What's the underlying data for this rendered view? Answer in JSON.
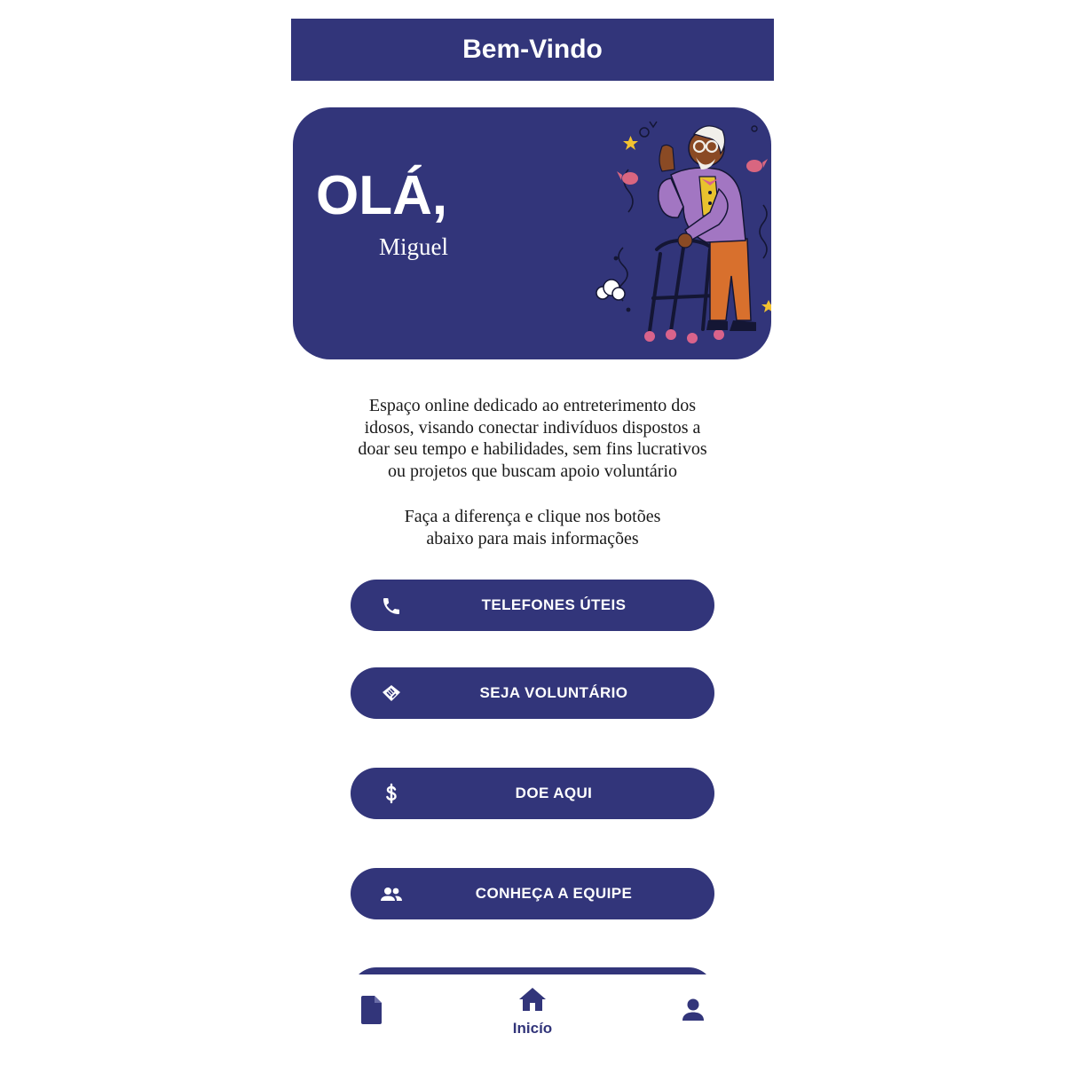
{
  "header": {
    "title": "Bem-Vindo"
  },
  "hero": {
    "greeting": "OLÁ,",
    "user_name": "Miguel",
    "illustration": "elderly-man-with-walker-illustration"
  },
  "intro": {
    "description_lines": [
      "Espaço online dedicado ao entreterimento dos",
      "idosos, visando conectar indivíduos dispostos a",
      "doar seu tempo e habilidades, sem fins lucrativos",
      "ou projetos que buscam apoio voluntário"
    ],
    "cta_lines": [
      "Faça a diferença e clique nos botões",
      "abaixo para mais informações"
    ]
  },
  "actions": [
    {
      "label": "TELEFONES ÚTEIS",
      "icon": "phone-icon"
    },
    {
      "label": "SEJA VOLUNTÁRIO",
      "icon": "handshake-icon"
    },
    {
      "label": "DOE AQUI",
      "icon": "dollar-icon"
    },
    {
      "label": "CONHEÇA A EQUIPE",
      "icon": "group-icon"
    }
  ],
  "bottom_nav": {
    "items": [
      {
        "label": "",
        "icon": "document-icon"
      },
      {
        "label": "Inicío",
        "icon": "home-icon",
        "active": true
      },
      {
        "label": "",
        "icon": "profile-icon"
      }
    ]
  },
  "colors": {
    "primary": "#32357a",
    "on_primary": "#ffffff",
    "background": "#ffffff",
    "text": "#1a1a1a"
  }
}
